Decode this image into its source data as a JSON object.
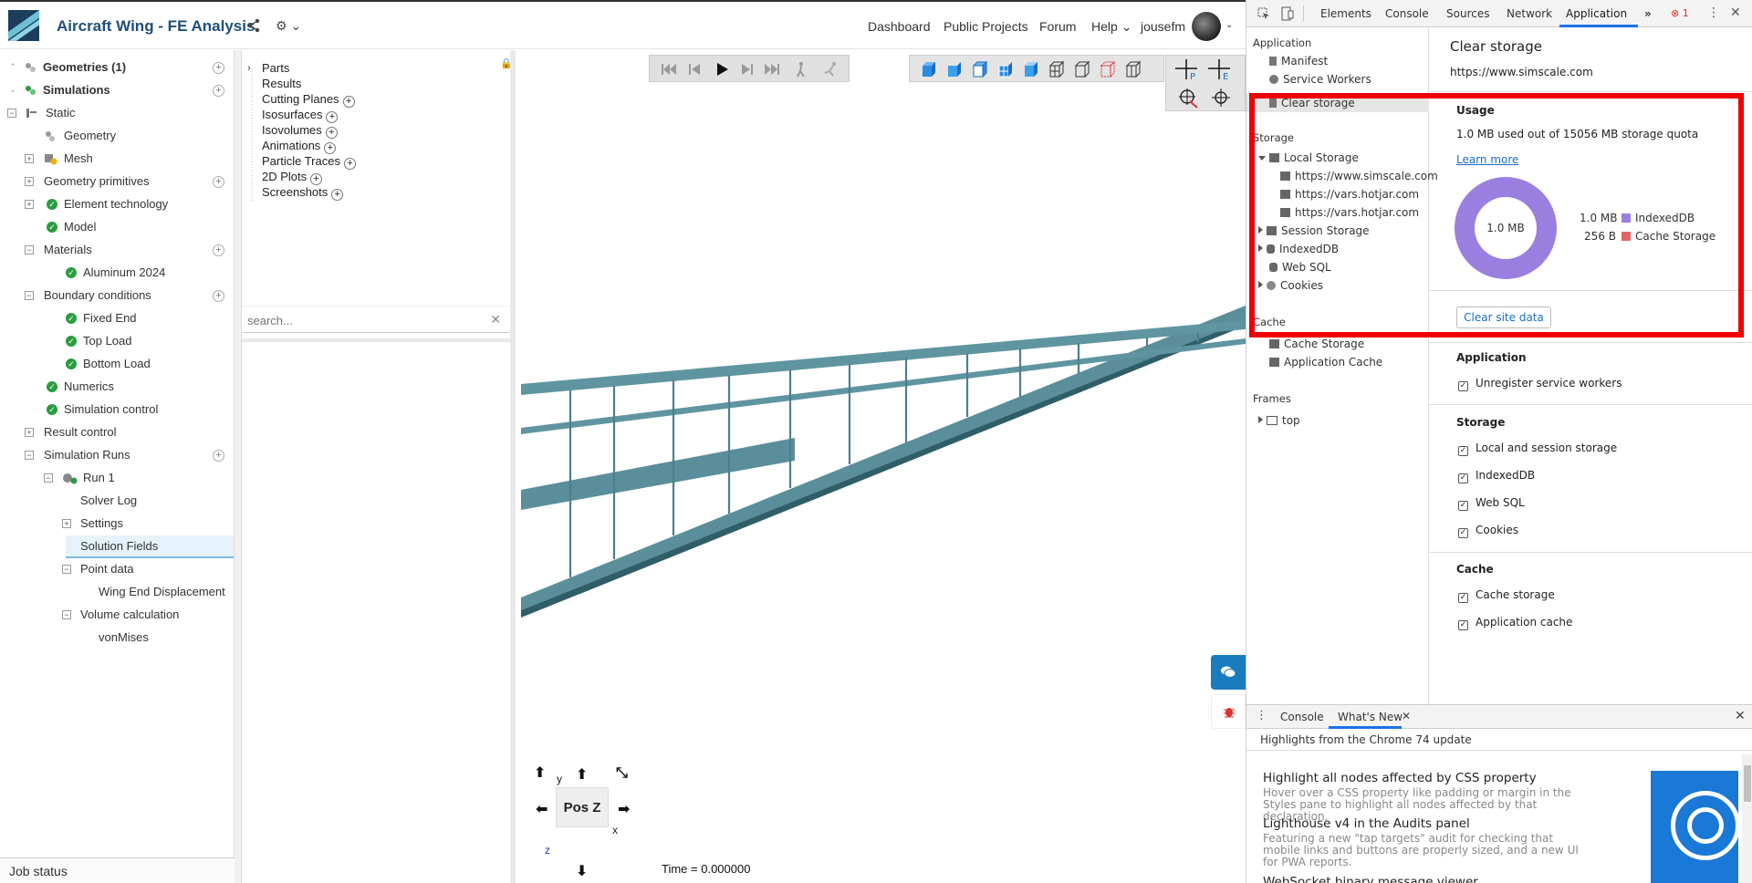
{
  "app": {
    "title": "Aircraft Wing - FE Analysis",
    "nav": [
      "Dashboard",
      "Public Projects",
      "Forum",
      "Help",
      "jousefm"
    ],
    "help_caret": "⌄",
    "share_icon": "share-icon",
    "settings_label": "⚙ ⌄"
  },
  "left_tree": {
    "geometries": "Geometries (1)",
    "simulations": "Simulations",
    "static": "Static",
    "geometry": "Geometry",
    "mesh": "Mesh",
    "geometry_primitives": "Geometry primitives",
    "element_technology": "Element technology",
    "model": "Model",
    "materials": "Materials",
    "aluminum": "Aluminum 2024",
    "boundary_conditions": "Boundary conditions",
    "fixed_end": "Fixed End",
    "top_load": "Top Load",
    "bottom_load": "Bottom Load",
    "numerics": "Numerics",
    "simulation_control": "Simulation control",
    "result_control": "Result control",
    "simulation_runs": "Simulation Runs",
    "run1": "Run 1",
    "solver_log": "Solver Log",
    "settings": "Settings",
    "solution_fields": "Solution Fields",
    "point_data": "Point data",
    "wing_end_displacement": "Wing End Displacement",
    "volume_calculation": "Volume calculation",
    "von_mises": "vonMises",
    "job_status": "Job status"
  },
  "post_tree": {
    "parts": "Parts",
    "results": "Results",
    "cutting_planes": "Cutting Planes",
    "isosurfaces": "Isosurfaces",
    "isovolumes": "Isovolumes",
    "animations": "Animations",
    "particle_traces": "Particle Traces",
    "plots_2d": "2D Plots",
    "screenshots": "Screenshots",
    "search_placeholder": "search..."
  },
  "viewport": {
    "orientation_label": "Pos Z",
    "axis_y": "y",
    "axis_x": "x",
    "axis_z": "z",
    "time": "Time = 0.000000",
    "wing_color": "#5a8e9a"
  },
  "devtools": {
    "tabs": [
      "Elements",
      "Console",
      "Sources",
      "Network",
      "Application"
    ],
    "more": "»",
    "error_count": "1",
    "active_tab": "Application",
    "sidebar": {
      "application_header": "Application",
      "manifest": "Manifest",
      "service_workers": "Service Workers",
      "clear_storage": "Clear storage",
      "storage_header": "Storage",
      "local_storage": "Local Storage",
      "local_origins": [
        "https://www.simscale.com",
        "https://vars.hotjar.com",
        "https://vars.hotjar.com"
      ],
      "session_storage": "Session Storage",
      "indexeddb": "IndexedDB",
      "web_sql": "Web SQL",
      "cookies": "Cookies",
      "cache_header": "Cache",
      "cache_storage": "Cache Storage",
      "application_cache": "Application Cache",
      "frames_header": "Frames",
      "top": "top"
    },
    "main": {
      "title": "Clear storage",
      "origin": "https://www.simscale.com",
      "usage_header": "Usage",
      "usage_text": "1.0 MB used out of 15056 MB storage quota",
      "learn_more": "Learn more",
      "donut_label": "1.0 MB",
      "legend": [
        {
          "value": "1.0 MB",
          "label": "IndexedDB",
          "color": "#9b7fe0"
        },
        {
          "value": "256 B",
          "label": "Cache Storage",
          "color": "#e06666"
        }
      ],
      "clear_button": "Clear site data",
      "application_header": "Application",
      "unregister": "Unregister service workers",
      "storage_header": "Storage",
      "storage_items": [
        "Local and session storage",
        "IndexedDB",
        "Web SQL",
        "Cookies"
      ],
      "cache_header": "Cache",
      "cache_items": [
        "Cache storage",
        "Application cache"
      ]
    },
    "drawer": {
      "console_tab": "Console",
      "whats_new_tab": "What's New",
      "highlights": "Highlights from the Chrome 74 update",
      "news": [
        {
          "title": "Highlight all nodes affected by CSS property",
          "desc": "Hover over a CSS property like padding or margin in the Styles pane to highlight all nodes affected by that declaration."
        },
        {
          "title": "Lighthouse v4 in the Audits panel",
          "desc": "Featuring a new \"tap targets\" audit for checking that mobile links and buttons are properly sized, and a new UI for PWA reports."
        },
        {
          "title": "WebSocket binary message viewer",
          "desc": ""
        }
      ]
    }
  }
}
